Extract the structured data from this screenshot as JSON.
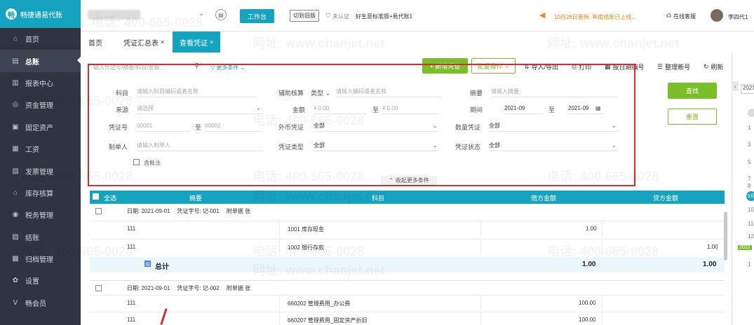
{
  "brand": {
    "name": "畅捷通易代账",
    "logo": "畅"
  },
  "sidebar": {
    "items": [
      {
        "label": "首页",
        "icon": "⌂"
      },
      {
        "label": "总账",
        "icon": "▤",
        "active": true
      },
      {
        "label": "报表中心",
        "icon": "▥"
      },
      {
        "label": "资金管理",
        "icon": "◎"
      },
      {
        "label": "固定资产",
        "icon": "▣"
      },
      {
        "label": "工资",
        "icon": "▦"
      },
      {
        "label": "发票管理",
        "icon": "▧"
      },
      {
        "label": "库存核算",
        "icon": "⌂"
      },
      {
        "label": "税务管理",
        "icon": "◉"
      },
      {
        "label": "结账",
        "icon": "▨"
      },
      {
        "label": "归档管理",
        "icon": "▩"
      },
      {
        "label": "设置",
        "icon": "✿"
      },
      {
        "label": "畅会员",
        "icon": "V"
      }
    ]
  },
  "topbar": {
    "workbench": "工作台",
    "old_version": "切到旧版",
    "cert": "未认证",
    "edition": "好生意标准版+易代账1",
    "notice": "10月26日更新: 年度结账已上线...",
    "support": "在线客服",
    "user": "李四代1"
  },
  "tabs": [
    {
      "label": "首页"
    },
    {
      "label": "凭证汇总表",
      "close": "×"
    },
    {
      "label": "查看凭证",
      "close": "×",
      "active": true
    }
  ],
  "search": {
    "placeholder": "输入凭证号/摘要/科目/金额...",
    "more": "更多条件"
  },
  "toolbar": {
    "new": "+ 新增凭证",
    "batch": "批量操作",
    "import_export": "导入/导出",
    "print": "打印",
    "renumber": "按日期编号",
    "tidy": "整理断号",
    "refresh": "刷新"
  },
  "filters": {
    "subject": {
      "label": "科目",
      "placeholder": "请输入科目编码或者名称"
    },
    "aux": {
      "label": "辅助核算",
      "type": "类型",
      "placeholder": "请输入编码或者名称"
    },
    "summary": {
      "label": "摘要",
      "placeholder": "请输入摘要"
    },
    "source": {
      "label": "来源",
      "placeholder": "请选择"
    },
    "amount": {
      "label": "金额",
      "from": "¥ 0.00",
      "to_label": "至",
      "to": "¥ 0.00"
    },
    "period": {
      "label": "期间",
      "from": "2021-09",
      "to_label": "至",
      "to": "2021-09"
    },
    "voucher_no": {
      "label": "凭证号",
      "from": "00001",
      "to_label": "至",
      "to": "00002"
    },
    "foreign": {
      "label": "外币凭证",
      "value": "全部"
    },
    "qty": {
      "label": "数量凭证",
      "value": "全部"
    },
    "maker": {
      "label": "制单人",
      "placeholder": "请输入制单人"
    },
    "vtype": {
      "label": "凭证类型",
      "value": "全部"
    },
    "vstatus": {
      "label": "凭证状态",
      "value": "全部"
    },
    "annotated": "含批注",
    "collapse": "收起更多条件",
    "query": "查找",
    "reset": "重置"
  },
  "table": {
    "headers": {
      "select_all": "全选",
      "summary": "摘要",
      "subject": "科目",
      "debit": "借方金额",
      "credit": "贷方金额"
    },
    "groups": [
      {
        "date": "日期: 2021-09-01",
        "vno": "凭证字号: 记-001",
        "attach": "附单据  张",
        "lines": [
          {
            "summary": "111",
            "subject": "1001 库存现金",
            "debit": "1.00",
            "credit": ""
          },
          {
            "summary": "111",
            "subject": "1002 银行存款",
            "debit": "",
            "credit": "1.00"
          }
        ],
        "total": {
          "label": "总计",
          "debit": "1.00",
          "credit": "1.00"
        }
      },
      {
        "date": "日期: 2021-09-01",
        "vno": "凭证字号: 记-002",
        "attach": "附单据  张",
        "lines": [
          {
            "summary": "111",
            "subject": "660202 管理费用_办公费",
            "debit": "100.00",
            "credit": ""
          },
          {
            "summary": "111",
            "subject": "660207 管理费用_固定资产折旧",
            "debit": "100.00",
            "credit": ""
          }
        ]
      }
    ]
  },
  "right_panel": {
    "year": "2021",
    "months": [
      "1",
      "3",
      "5",
      "7",
      "8",
      "9",
      "10",
      "11",
      "12",
      "1"
    ],
    "active": "9月",
    "year_label": "2022"
  },
  "watermark": {
    "phone": "电话: 400-665-0028",
    "site": "网址: www.chanjet.net"
  }
}
